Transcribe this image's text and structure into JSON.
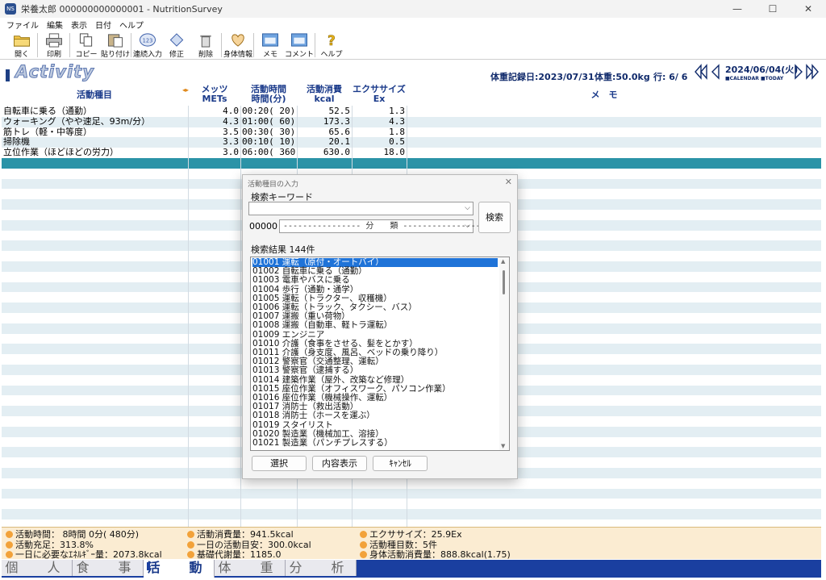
{
  "window": {
    "title": "栄養太郎 000000000000001 - NutritionSurvey",
    "controls": [
      "—",
      "☐",
      "✕"
    ]
  },
  "menu": [
    "ファイル",
    "編集",
    "表示",
    "日付",
    "ヘルプ"
  ],
  "toolbar": [
    {
      "label": "開く",
      "icon": "folder-icon"
    },
    {
      "label": "印刷",
      "icon": "printer-icon"
    },
    {
      "label": "コピー",
      "icon": "copy-icon"
    },
    {
      "label": "貼り付け",
      "icon": "paste-icon"
    },
    {
      "label": "連続入力",
      "icon": "batch-input-icon"
    },
    {
      "label": "修正",
      "icon": "edit-icon"
    },
    {
      "label": "削除",
      "icon": "trash-icon"
    },
    {
      "label": "身体情報",
      "icon": "heart-icon"
    },
    {
      "label": "メモ",
      "icon": "memo-icon"
    },
    {
      "label": "コメント",
      "icon": "comment-icon"
    },
    {
      "label": "ヘルプ",
      "icon": "help-icon"
    }
  ],
  "header": {
    "section": "Activity",
    "weight_record_date": "体重記録日:2023/07/31",
    "weight": "体重:50.0kg",
    "row_info": "行: 6/ 6",
    "date": "2024/06/04(火)",
    "date_sub": "■CALENDAR ■TODAY"
  },
  "columns": {
    "name": "活動種目",
    "mets_1": "メッツ",
    "mets_2": "METs",
    "time_1": "活動時間",
    "time_2": "時間(分)",
    "kcal_1": "活動消費",
    "kcal_2": "kcal",
    "ex_1": "エクササイズ",
    "ex_2": "Ex",
    "memo": "メ　モ"
  },
  "rows": [
    {
      "name": "自転車に乗る（通勤）",
      "mets": "4.0",
      "time": "00:20(  20)",
      "kcal": "52.5",
      "ex": "1.3"
    },
    {
      "name": "ウォーキング（やや速足、93m/分）",
      "mets": "4.3",
      "time": "01:00(  60)",
      "kcal": "173.3",
      "ex": "4.3"
    },
    {
      "name": "筋トレ（軽・中等度）",
      "mets": "3.5",
      "time": "00:30(  30)",
      "kcal": "65.6",
      "ex": "1.8"
    },
    {
      "name": "掃除機",
      "mets": "3.3",
      "time": "00:10(  10)",
      "kcal": "20.1",
      "ex": "0.5"
    },
    {
      "name": "立位作業（ほどほどの労力）",
      "mets": "3.0",
      "time": "06:00( 360)",
      "kcal": "630.0",
      "ex": "18.0"
    }
  ],
  "status": {
    "activity_time": "活動時間：  8時間  0分( 480分)",
    "activity_kcal": "活動消費量：941.5kcal",
    "exercise": "エクササイズ：25.9Ex",
    "fulfillment": "活動充足：313.8%",
    "daily_target": "一日の活動目安：300.0kcal",
    "count": "活動種目数：5件",
    "energy_need": "一日に必要なｴﾈﾙｷﾞｰ量：2073.8kcal",
    "bmr": "基礎代謝量：1185.0",
    "body_activity": "身体活動消費量：888.8kcal(1.75)"
  },
  "tabs": [
    "個　人",
    "食　事",
    "活　動",
    "体　重",
    "分　析"
  ],
  "active_tab": "活　動",
  "dialog": {
    "title": "活動種目の入力",
    "keyword_label": "検索キーワード",
    "keyword_value": "",
    "category_code": "00000",
    "category_text": "---------------- 分　　類 ----------------",
    "search_button": "検索",
    "results_label": "検索結果 144件",
    "results": [
      "01001 運転（原付・オートバイ）",
      "01002 自転車に乗る（通勤）",
      "01003 電車やバスに乗る",
      "01004 歩行（通勤・通学）",
      "01005 運転（トラクター、収穫機）",
      "01006 運転（トラック、タクシー、バス）",
      "01007 運搬（重い荷物）",
      "01008 運搬（自動車、軽トラ運転）",
      "01009 エンジニア",
      "01010 介護（食事をさせる、髪をとかす）",
      "01011 介護（身支度、風呂、ベッドの乗り降り）",
      "01012 警察官（交通整理、運転）",
      "01013 警察官（逮捕する）",
      "01014 建築作業（屋外、改築など修理）",
      "01015 座位作業（オフィスワーク、パソコン作業）",
      "01016 座位作業（機械操作、運転）",
      "01017 消防士（救出活動）",
      "01018 消防士（ホースを運ぶ）",
      "01019 スタイリスト",
      "01020 製造業（機械加工、溶接）",
      "01021 製造業（パンチプレスする）"
    ],
    "select_button": "選択",
    "detail_button": "内容表示",
    "cancel_button": "ｷｬﾝｾﾙ"
  }
}
